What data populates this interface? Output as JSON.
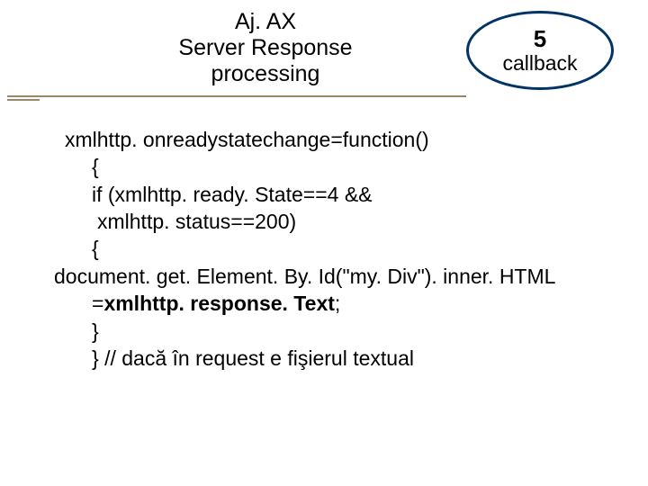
{
  "title": {
    "line1": "Aj. AX",
    "line2": "Server Response",
    "line3": "processing"
  },
  "badge": {
    "number": "5",
    "label": "callback"
  },
  "code": {
    "l1": "xmlhttp. onreadystatechange=function()",
    "l2": "{",
    "l3": "if (xmlhttp. ready. State==4 &&",
    "l4": "xmlhttp. status==200)",
    "l5": "{",
    "l6a": "document. get. Element. By. Id(\"my. Div\"). inner. HTML",
    "l6b_pre": "=",
    "l6b_bold": "xmlhttp. response. Text",
    "l6b_post": ";",
    "l7": "}",
    "l8": "}  // dacă în request e fişierul textual"
  }
}
